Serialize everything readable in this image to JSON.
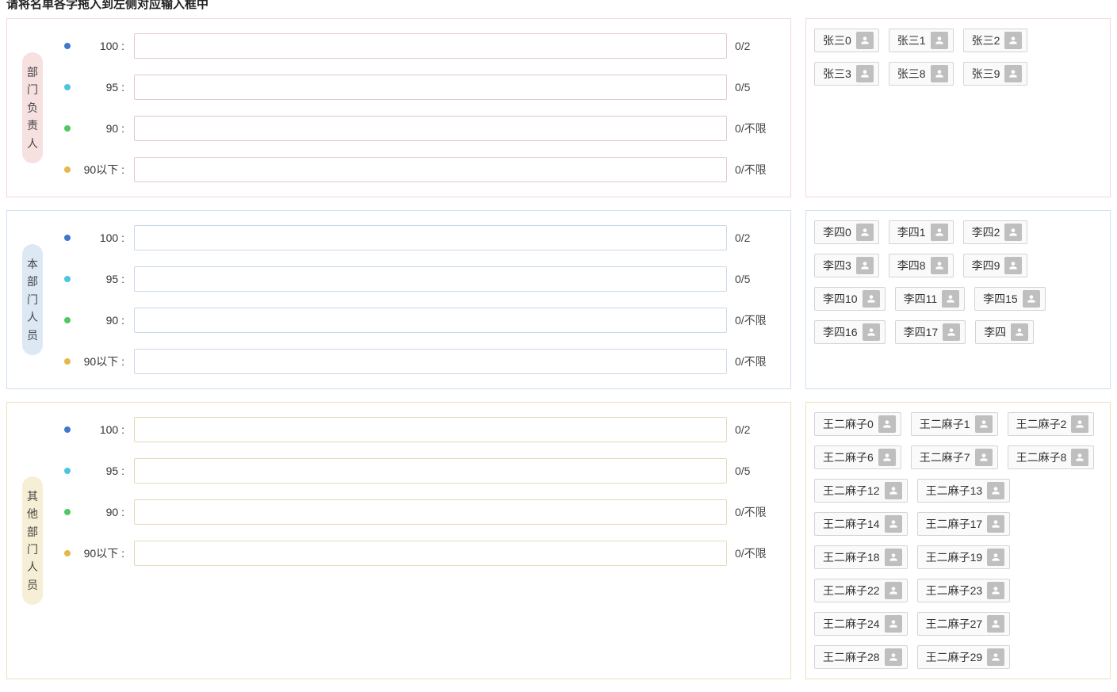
{
  "header": {
    "title": "请将名单各字拖入到左侧对应输入框中"
  },
  "scoreRows": [
    {
      "dotClass": "dot-blue",
      "label": "100 :",
      "counter": "0/2"
    },
    {
      "dotClass": "dot-cyan",
      "label": "95 :",
      "counter": "0/5"
    },
    {
      "dotClass": "dot-green",
      "label": "90 :",
      "counter": "0/不限"
    },
    {
      "dotClass": "dot-orange",
      "label": "90以下 :",
      "counter": "0/不限"
    }
  ],
  "sections": [
    {
      "id": "dept-head",
      "colorClass": "sec-pink",
      "groupLabel": "部门负责人",
      "people": [
        "张三0",
        "张三1",
        "张三2",
        "张三3",
        "张三8",
        "张三9"
      ]
    },
    {
      "id": "this-dept",
      "colorClass": "sec-blue",
      "groupLabel": "本部门人员",
      "people": [
        "李四0",
        "李四1",
        "李四2",
        "李四3",
        "李四8",
        "李四9",
        "李四10",
        "李四11",
        "李四15",
        "李四16",
        "李四17",
        "李四"
      ]
    },
    {
      "id": "other-dept",
      "colorClass": "sec-yellow",
      "groupLabel": "其他部门人员",
      "people": [
        "王二麻子0",
        "王二麻子1",
        "王二麻子2",
        "王二麻子6",
        "王二麻子7",
        "王二麻子8",
        "王二麻子12",
        "王二麻子13",
        "王二麻子14",
        "王二麻子17",
        "王二麻子18",
        "王二麻子19",
        "王二麻子22",
        "王二麻子23",
        "王二麻子24",
        "王二麻子27",
        "王二麻子28",
        "王二麻子29"
      ]
    }
  ]
}
